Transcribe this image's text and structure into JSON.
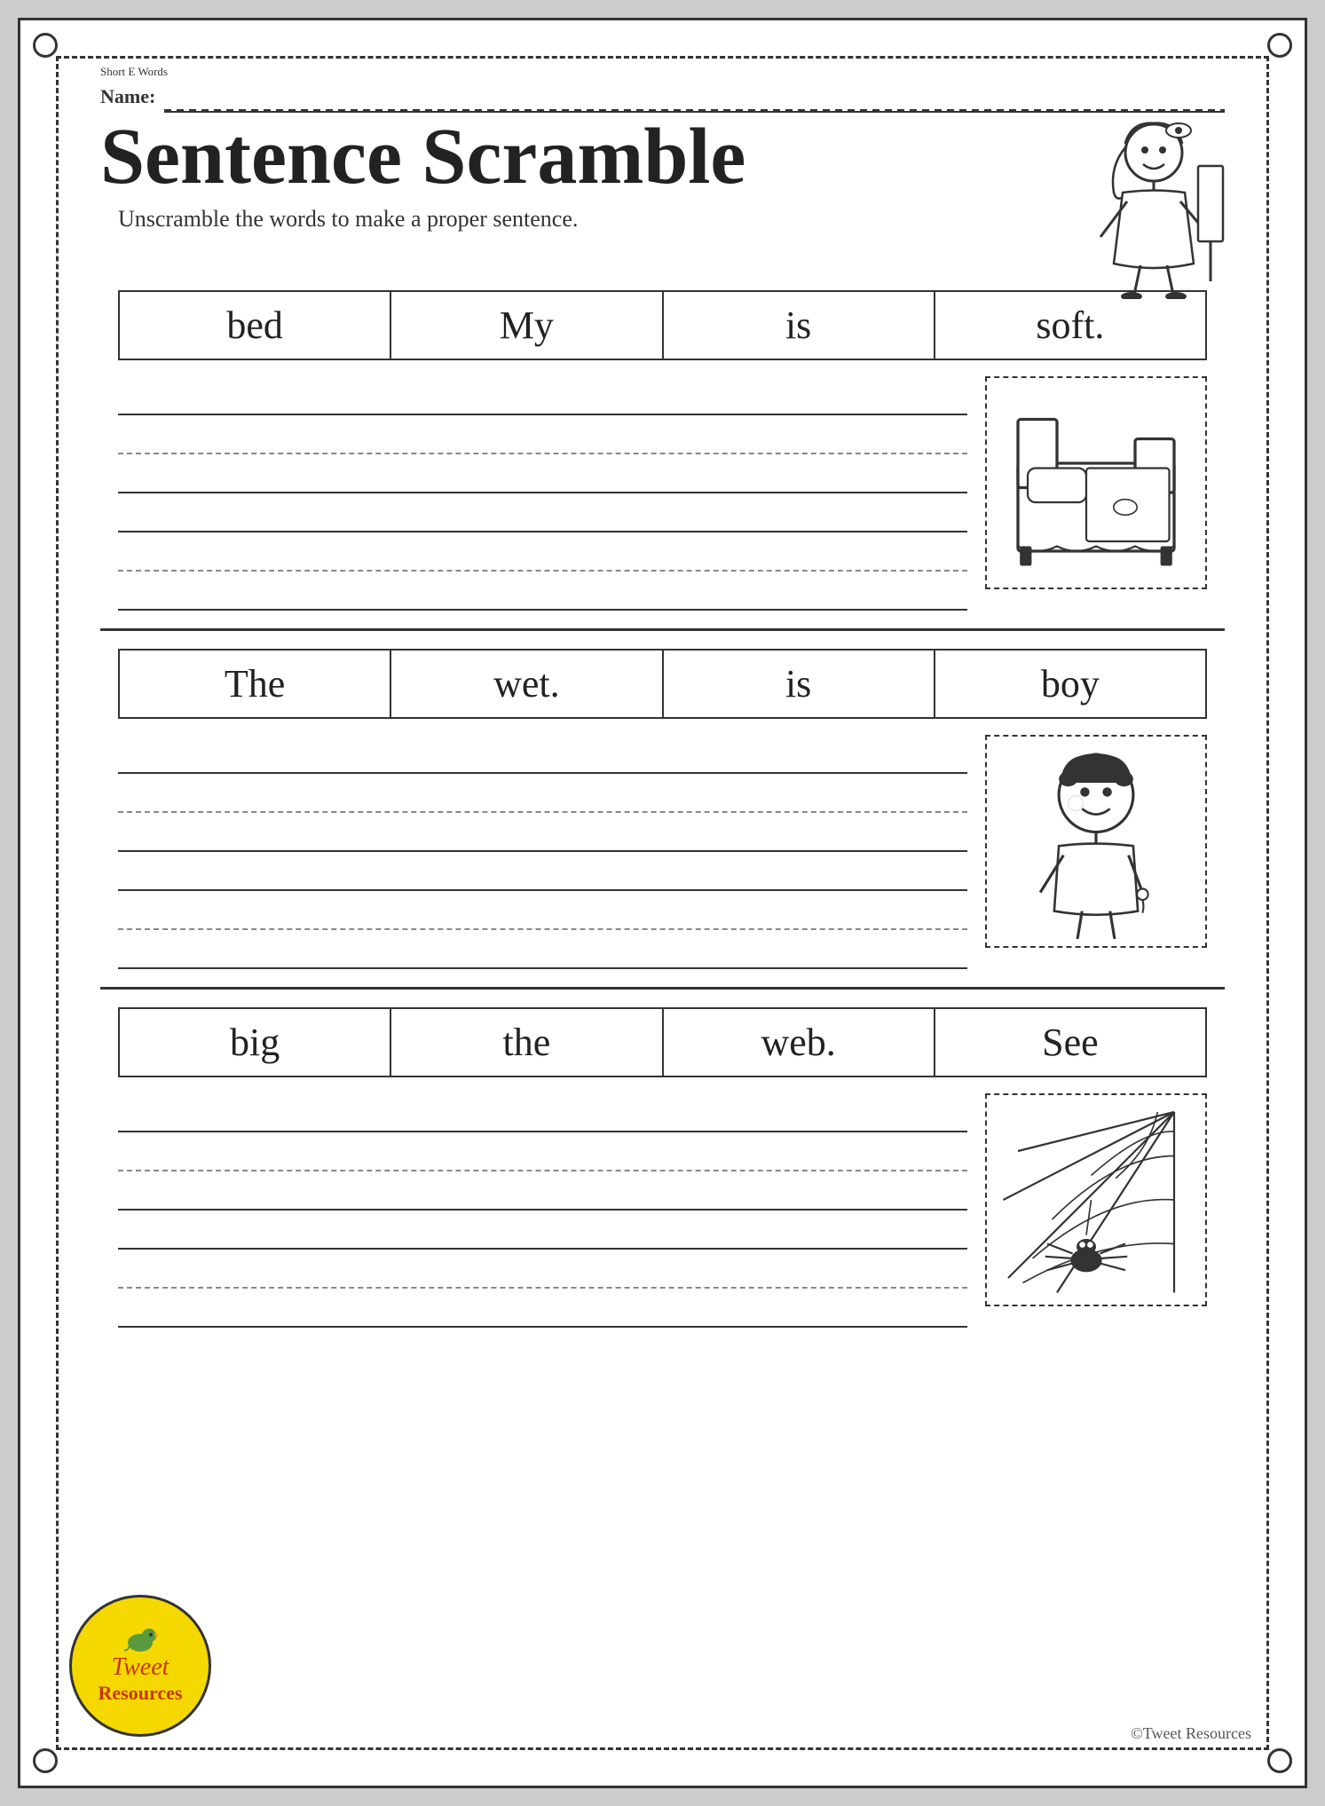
{
  "page": {
    "short_e_label": "Short E Words",
    "name_label": "Name:",
    "title": "Sentence Scramble",
    "subtitle": "Unscramble the words to make a proper sentence.",
    "sentences": [
      {
        "id": 1,
        "words": [
          "bed",
          "My",
          "is",
          "soft."
        ],
        "image_alt": "bed illustration"
      },
      {
        "id": 2,
        "words": [
          "The",
          "wet.",
          "is",
          "boy"
        ],
        "image_alt": "wet boy illustration"
      },
      {
        "id": 3,
        "words": [
          "big",
          "the",
          "web.",
          "See"
        ],
        "image_alt": "spider web illustration"
      }
    ],
    "logo": {
      "tweet": "Tweet",
      "resources": "Resources"
    },
    "copyright": "©Tweet Resources"
  }
}
